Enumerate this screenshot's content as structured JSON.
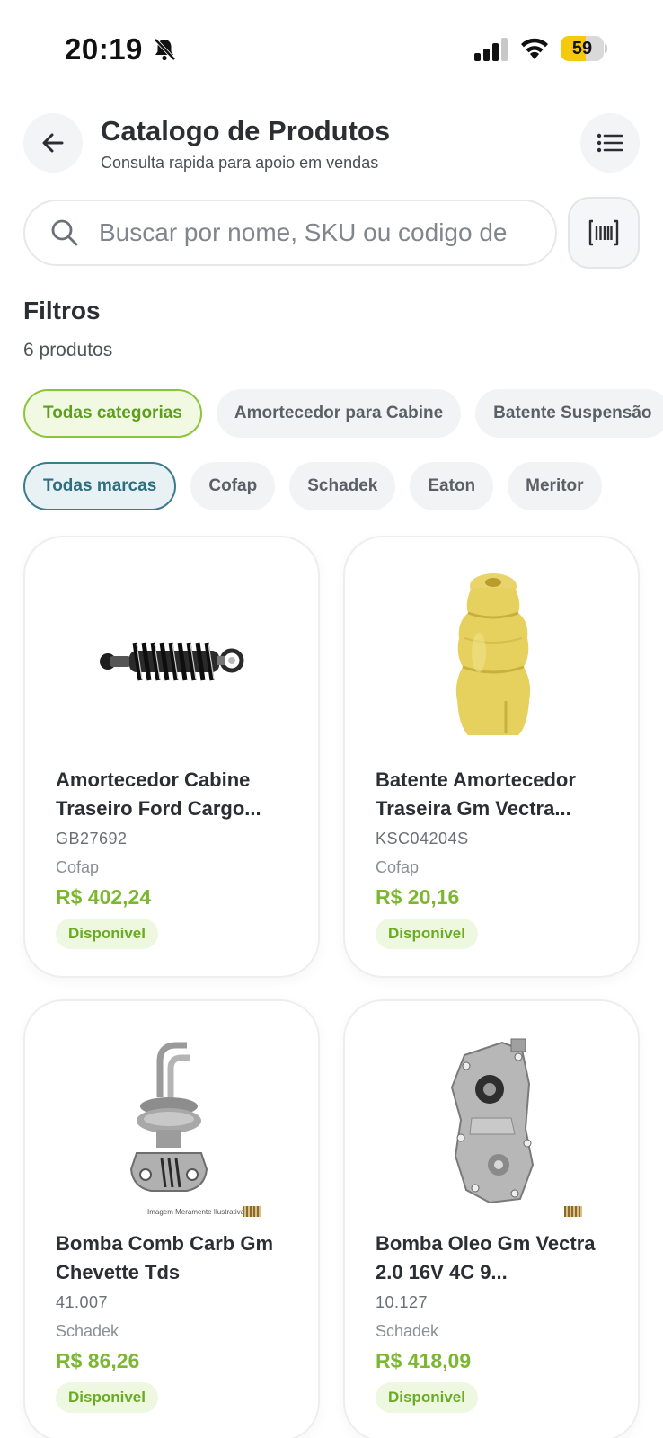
{
  "status_bar": {
    "time": "20:19",
    "battery_level": "59",
    "battery_fraction": 0.59
  },
  "header": {
    "title": "Catalogo de Produtos",
    "subtitle": "Consulta rapida para apoio em vendas"
  },
  "search": {
    "placeholder": "Buscar por nome, SKU ou codigo de",
    "value": ""
  },
  "filters": {
    "title": "Filtros",
    "count_label": "6 produtos",
    "categories": [
      "Todas categorias",
      "Amortecedor para Cabine",
      "Batente Suspensão"
    ],
    "brands": [
      "Todas marcas",
      "Cofap",
      "Schadek",
      "Eaton",
      "Meritor"
    ]
  },
  "products": [
    {
      "name": "Amortecedor Cabine Traseiro Ford Cargo...",
      "sku": "GB27692",
      "brand": "Cofap",
      "price": "R$ 402,24",
      "status": "Disponivel",
      "image_icon": "shock-absorber-icon"
    },
    {
      "name": "Batente Amortecedor Traseira Gm Vectra...",
      "sku": "KSC04204S",
      "brand": "Cofap",
      "price": "R$ 20,16",
      "status": "Disponivel",
      "image_icon": "bump-stop-icon"
    },
    {
      "name": "Bomba Comb Carb Gm Chevette Tds",
      "sku": "41.007",
      "brand": "Schadek",
      "price": "R$ 86,26",
      "status": "Disponivel",
      "image_icon": "fuel-pump-icon",
      "watermark": "Imagem Meramente Ilustrativa"
    },
    {
      "name": "Bomba Oleo Gm Vectra 2.0 16V 4C 9...",
      "sku": "10.127",
      "brand": "Schadek",
      "price": "R$ 418,09",
      "status": "Disponivel",
      "image_icon": "oil-pump-icon"
    }
  ],
  "colors": {
    "accent_green": "#7cb82f",
    "brand_teal": "#2d6f80",
    "battery_yellow": "#f6c90e"
  }
}
